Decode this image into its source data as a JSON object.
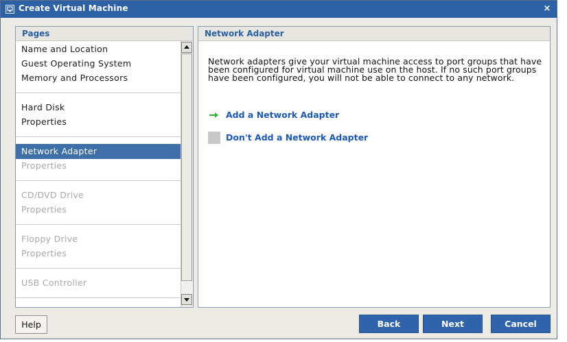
{
  "window": {
    "title": "Create Virtual Machine",
    "close_label": "×"
  },
  "pages_panel": {
    "header": "Pages",
    "items": [
      {
        "label": "Name and Location",
        "state": "enabled"
      },
      {
        "label": "Guest Operating System",
        "state": "enabled"
      },
      {
        "label": "Memory and Processors",
        "state": "enabled"
      },
      {
        "label": "Hard Disk",
        "state": "enabled"
      },
      {
        "label": "Properties",
        "state": "enabled"
      },
      {
        "label": "Network Adapter",
        "state": "selected"
      },
      {
        "label": "Properties",
        "state": "disabled"
      },
      {
        "label": "CD/DVD Drive",
        "state": "disabled"
      },
      {
        "label": "Properties",
        "state": "disabled"
      },
      {
        "label": "Floppy Drive",
        "state": "disabled"
      },
      {
        "label": "Properties",
        "state": "disabled"
      },
      {
        "label": "USB Controller",
        "state": "disabled"
      }
    ]
  },
  "content_panel": {
    "header": "Network Adapter",
    "description": "Network adapters give your virtual machine access to port groups that have been configured for virtual machine use on the host. If no such port groups have been configured, you will not be able to connect to any network.",
    "options": [
      {
        "label": "Add a Network Adapter",
        "icon": "green-arrow-icon"
      },
      {
        "label": "Don't Add a Network Adapter",
        "icon": "gray-square-icon"
      }
    ]
  },
  "buttons": {
    "help": "Help",
    "back": "Back",
    "next": "Next",
    "cancel": "Cancel"
  },
  "colors": {
    "titlebar": "#2d61a6",
    "selection": "#3e6fa9",
    "link": "#1a57b8",
    "primary_button": "#2f64ac",
    "arrow": "#2db52d"
  }
}
